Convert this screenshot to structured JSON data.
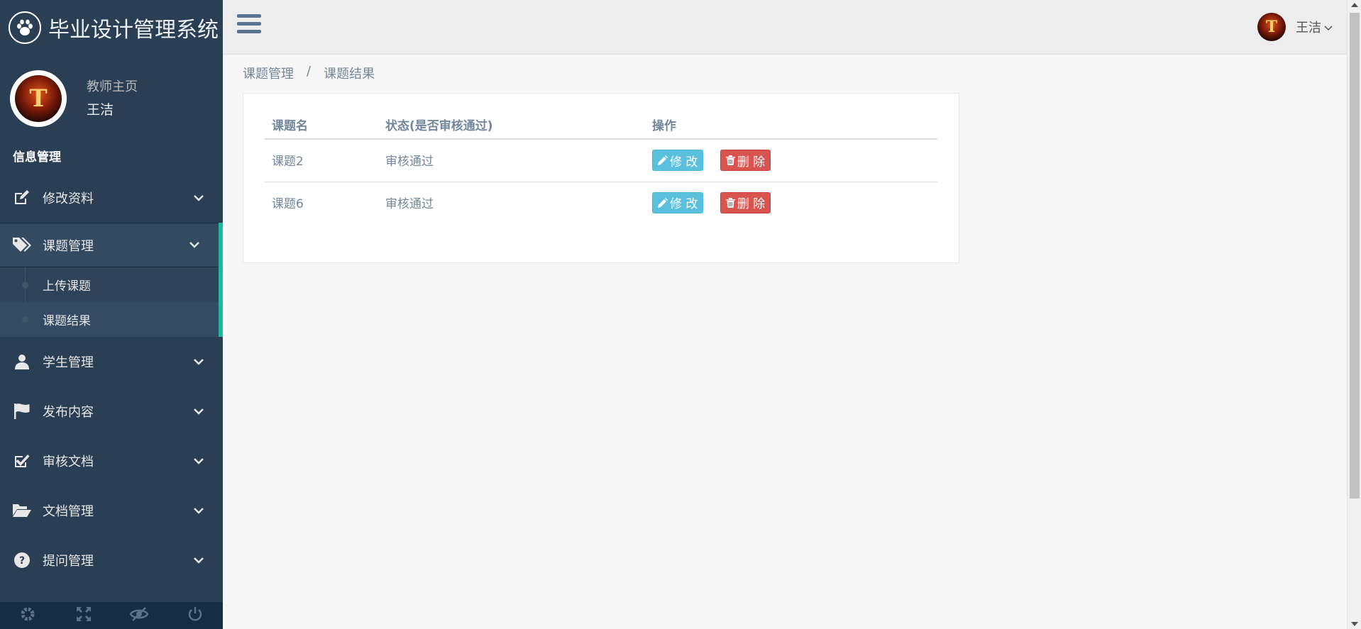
{
  "brand": {
    "title": "毕业设计管理系统",
    "logo_icon": "paw-icon"
  },
  "profile": {
    "welcome": "教师主页",
    "name": "王洁",
    "avatar_letter": "T"
  },
  "sidebar": {
    "section_title": "信息管理",
    "items": [
      {
        "label": "修改资料",
        "icon": "edit-icon"
      },
      {
        "label": "课题管理",
        "icon": "tags-icon",
        "expanded": true,
        "children": [
          {
            "label": "上传课题"
          },
          {
            "label": "课题结果",
            "current": true
          }
        ]
      },
      {
        "label": "学生管理",
        "icon": "user-icon"
      },
      {
        "label": "发布内容",
        "icon": "flag-icon"
      },
      {
        "label": "审核文档",
        "icon": "check-square-icon"
      },
      {
        "label": "文档管理",
        "icon": "folder-open-icon"
      },
      {
        "label": "提问管理",
        "icon": "question-circle-icon"
      }
    ],
    "footer_icons": [
      "settings-icon",
      "fullscreen-icon",
      "eye-slash-icon",
      "power-icon"
    ]
  },
  "topnav": {
    "user_name": "王洁"
  },
  "breadcrumb": {
    "parent": "课题管理",
    "separator": "/",
    "current": "课题结果"
  },
  "table": {
    "headers": [
      "课题名",
      "状态(是否审核通过)",
      "操作"
    ],
    "rows": [
      {
        "name": "课题2",
        "status": "审核通过"
      },
      {
        "name": "课题6",
        "status": "审核通过"
      }
    ],
    "edit_label": "修 改",
    "delete_label": "删 除"
  },
  "colors": {
    "sidebar_bg": "#2a3f54",
    "accent": "#1abb9c",
    "edit_btn": "#5bc0de",
    "delete_btn": "#d9534f"
  }
}
